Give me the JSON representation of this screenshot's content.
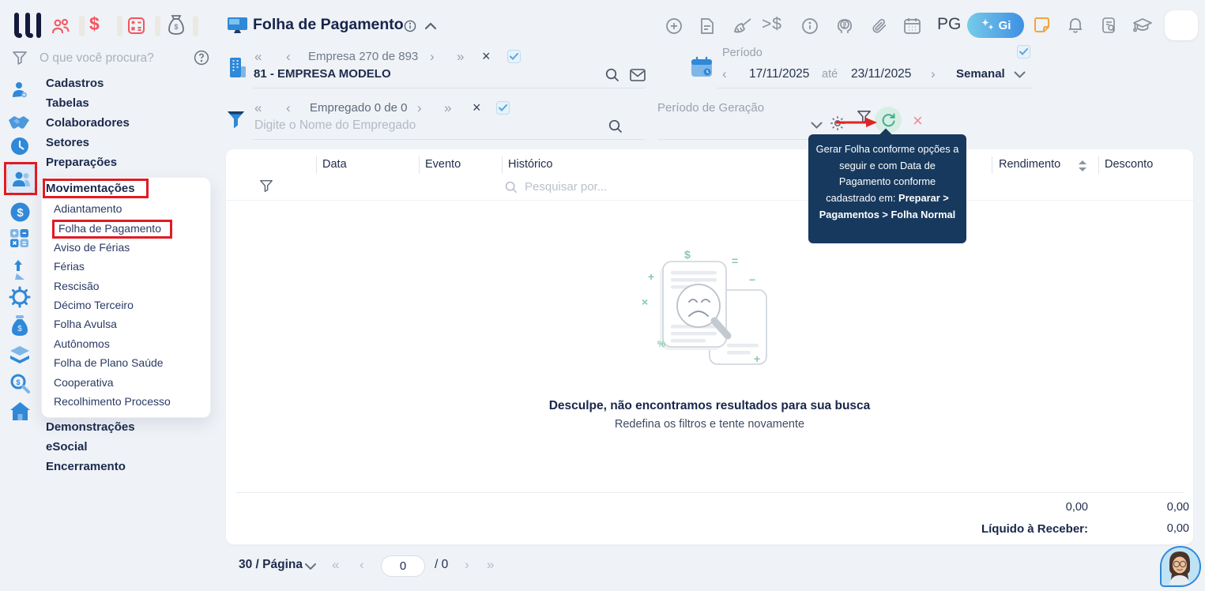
{
  "glyphs": {
    "first": "«",
    "prev": "‹",
    "next": "›",
    "last": "»",
    "close": "×",
    "dollar": "$",
    "gt_dollar": ">$",
    "question": "?",
    "plus": "+",
    "minus": "−",
    "equals": "=",
    "times": "×",
    "percent": "%"
  },
  "topbar": {
    "title": "Folha de Pagamento",
    "pg_label": "PG",
    "gi_label": "Gi"
  },
  "sidebar": {
    "search_placeholder": "O que você procura?",
    "items": [
      "Cadastros",
      "Tabelas",
      "Colaboradores",
      "Setores",
      "Preparações",
      "Movimentações",
      "Demonstrações",
      "eSocial",
      "Encerramento"
    ],
    "submenu": [
      "Adiantamento",
      "Folha de Pagamento",
      "Aviso de Férias",
      "Férias",
      "Rescisão",
      "Décimo Terceiro",
      "Folha Avulsa",
      "Autônomos",
      "Folha de Plano Saúde",
      "Cooperativa",
      "Recolhimento Processo"
    ]
  },
  "company_nav": {
    "label": "Empresa 270 de 893",
    "value": "81 - EMPRESA MODELO",
    "checked": true
  },
  "employee_nav": {
    "label": "Empregado 0 de 0",
    "placeholder": "Digite o Nome do Empregado",
    "checked": true
  },
  "period": {
    "label": "Período",
    "start": "17/11/2025",
    "until": "até",
    "end": "23/11/2025",
    "mode": "Semanal",
    "checked": true
  },
  "generation": {
    "label": "Período de Geração",
    "tooltip_text": "Gerar Folha conforme opções a seguir e com Data de Pagamento conforme cadastrado em: ",
    "tooltip_bold": "Preparar > Pagamentos > Folha Normal"
  },
  "table": {
    "columns": [
      "Data",
      "Evento",
      "Histórico",
      "Rendimento",
      "Desconto"
    ],
    "search_placeholder": "Pesquisar por..."
  },
  "empty_state": {
    "title": "Desculpe, não encontramos resultados para sua busca",
    "subtitle": "Redefina os filtros e tente novamente"
  },
  "totals": {
    "rendimento": "0,00",
    "desconto": "0,00",
    "liquido_label": "Líquido à Receber:",
    "liquido_value": "0,00"
  },
  "pagination": {
    "page_size": "30 / Página",
    "page_value": "0",
    "total_label": "/ 0"
  }
}
